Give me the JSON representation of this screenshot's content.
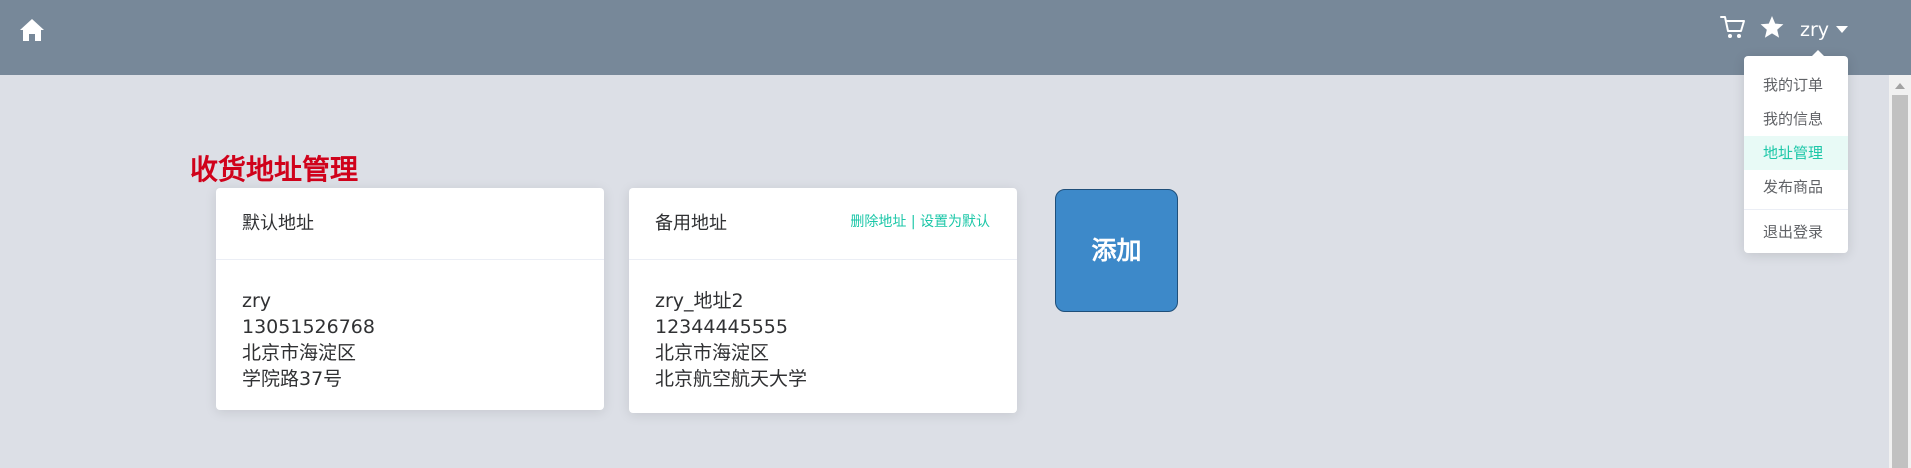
{
  "header": {
    "user_name": "zry",
    "background_color": "#778899"
  },
  "icons": {
    "home": "home-icon",
    "cart": "cart-icon",
    "favorites": "star-icon",
    "dropdown": "caret-down-icon"
  },
  "user_dropdown": {
    "items": [
      {
        "label": "我的订单"
      },
      {
        "label": "我的信息"
      },
      {
        "label": "地址管理",
        "active": true
      },
      {
        "label": "发布商品"
      }
    ],
    "logout_label": "退出登录",
    "active_color": "#1cc7a8"
  },
  "page": {
    "title": "收货地址管理",
    "title_color": "#d0021b"
  },
  "addresses": [
    {
      "header": "默认地址",
      "name": "zry",
      "phone": "13051526768",
      "region": "北京市海淀区",
      "detail": "学院路37号"
    },
    {
      "header": "备用地址",
      "name": "zry_地址2",
      "phone": "12344445555",
      "region": "北京市海淀区",
      "detail": "北京航空航天大学",
      "actions": {
        "delete_label": "删除地址",
        "separator": " | ",
        "set_default_label": "设置为默认"
      }
    }
  ],
  "add_button": {
    "label": "添加",
    "color": "#3d89c9"
  }
}
